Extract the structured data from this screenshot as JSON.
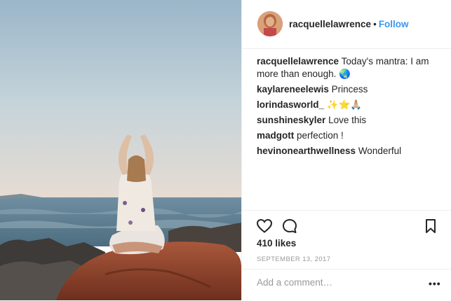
{
  "post": {
    "username": "racquellelawrence",
    "separator": "•",
    "follow_label": "Follow",
    "caption": "Today's mantra: I am more than enough. 🌏",
    "comments": [
      {
        "user": "kaylareneelewis",
        "text": "Princess"
      },
      {
        "user": "lorindasworld_",
        "text": "✨⭐🙏🏼"
      },
      {
        "user": "sunshineskyler",
        "text": "Love this"
      },
      {
        "user": "madgott",
        "text": "perfection !"
      },
      {
        "user": "hevinonearthwellness",
        "text": "Wonderful"
      }
    ],
    "likes": "410 likes",
    "date": "SEPTEMBER 13, 2017",
    "add_comment_placeholder": "Add a comment…",
    "more_label": "•••"
  },
  "icons": {
    "like": "heart-icon",
    "comment": "speech-bubble-icon",
    "save": "bookmark-icon"
  },
  "colors": {
    "link": "#3897f0",
    "text": "#262626",
    "muted": "#999999"
  }
}
